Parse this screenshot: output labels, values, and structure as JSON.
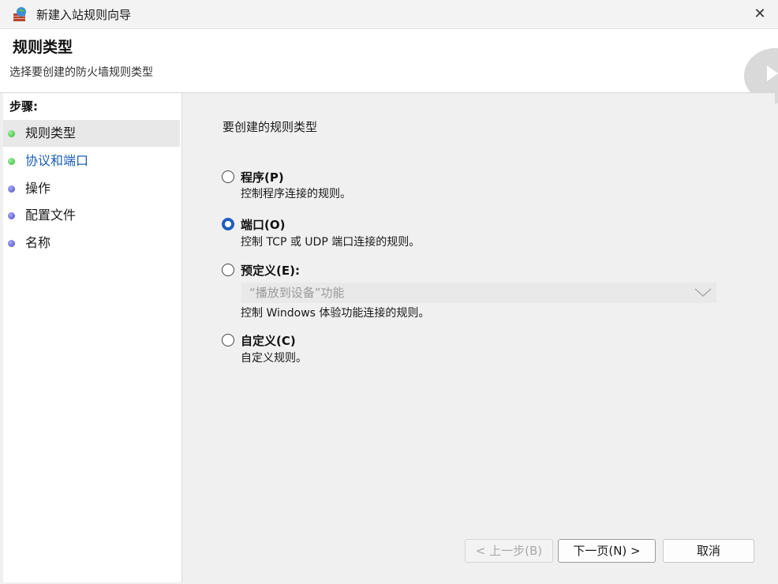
{
  "window": {
    "title": "新建入站规则向导",
    "close_glyph": "✕"
  },
  "header": {
    "title": "规则类型",
    "subtitle": "选择要创建的防火墙规则类型"
  },
  "sidebar": {
    "steps_label": "步骤:",
    "items": [
      {
        "label": "规则类型",
        "status": "green"
      },
      {
        "label": "协议和端口",
        "status": "green"
      },
      {
        "label": "操作",
        "status": "blue"
      },
      {
        "label": "配置文件",
        "status": "blue"
      },
      {
        "label": "名称",
        "status": "blue"
      }
    ]
  },
  "main": {
    "prompt": "要创建的规则类型",
    "options": [
      {
        "title": "程序(P)",
        "desc": "控制程序连接的规则。",
        "checked": false
      },
      {
        "title": "端口(O)",
        "desc": "控制 TCP 或 UDP 端口连接的规则。",
        "checked": true
      },
      {
        "title": "预定义(E):",
        "desc": "控制 Windows 体验功能连接的规则。",
        "checked": false
      },
      {
        "title": "自定义(C)",
        "desc": "自定义规则。",
        "checked": false
      }
    ],
    "predefined_select": {
      "value": "“播放到设备”功能"
    }
  },
  "footer": {
    "back_label": "< 上一步(B)",
    "next_label": "下一页(N) >",
    "cancel_label": "取消"
  },
  "colors": {
    "accent": "#1f5fbf",
    "link": "#1a5fb4",
    "step_done": "#2fb82f",
    "step_pending": "#4b4bc6"
  }
}
